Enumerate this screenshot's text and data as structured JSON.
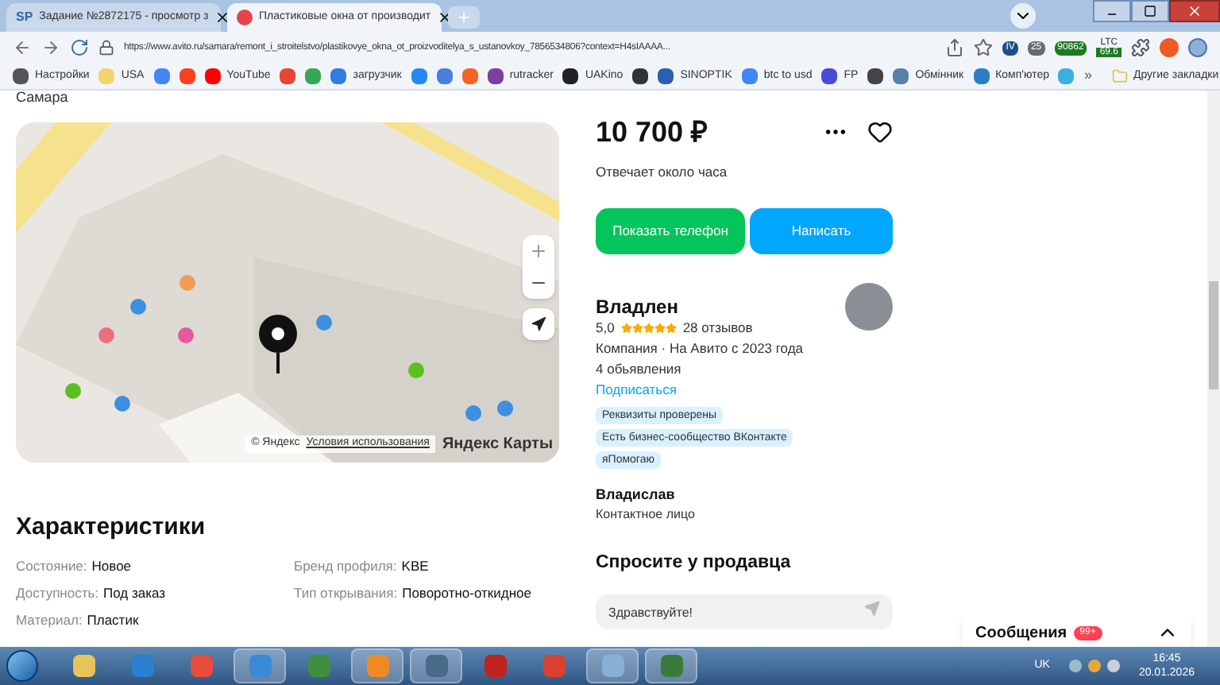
{
  "browser": {
    "tabs": [
      {
        "icon_text": "SP",
        "title": "Задание №2872175 - просмотр з",
        "selected": false
      },
      {
        "title": "Пластиковые окна от производит",
        "selected": true
      }
    ],
    "url": "https://www.avito.ru/samara/remont_i_stroitelstvo/plastikovye_okna_ot_proizvoditelya_s_ustanovkoy_7856534806?context=H4sIAAAA...",
    "extension_badges": [
      {
        "text": "IV",
        "color": "#1e4f8a"
      },
      {
        "text": "25",
        "color": "#6b6b6b"
      },
      {
        "text": "90862",
        "color": "#1f7a1f"
      },
      {
        "text": "69.6",
        "color": "#1f7a1f"
      }
    ],
    "extension_label": "LTC",
    "bookmarks": [
      {
        "label": "Настройки",
        "color": "#555555"
      },
      {
        "label": "USA",
        "color": "#f5d36b"
      },
      {
        "color": "#4285f4"
      },
      {
        "color": "#fc3f1d"
      },
      {
        "label": "YouTube",
        "color": "#ff0000"
      },
      {
        "color": "#ea4335"
      },
      {
        "color": "#34a853"
      },
      {
        "label": "загрузчик",
        "color": "#2f7de1"
      },
      {
        "color": "#2787f5"
      },
      {
        "color": "#4a7fe0"
      },
      {
        "color": "#f26522"
      },
      {
        "label": "rutracker",
        "color": "#7a3fa0"
      },
      {
        "label": "UAKino",
        "color": "#222222"
      },
      {
        "color": "#333333"
      },
      {
        "label": "SINOPTIK",
        "color": "#2b5fb0"
      },
      {
        "label": "btc to usd",
        "color": "#4285f4"
      },
      {
        "label": "FP",
        "color": "#4a4ad8"
      },
      {
        "color": "#444444"
      },
      {
        "label": "Обмінник",
        "color": "#5a7fa8"
      },
      {
        "label": "Комп'ютер",
        "color": "#2a7fc0"
      },
      {
        "color": "#3ab0e0"
      }
    ],
    "bookmarks_more": "»",
    "other_bookmarks": "Другие закладки"
  },
  "page": {
    "city": "Самара",
    "map": {
      "attribution": "© Яндекс",
      "terms_link": "Условия использования",
      "logo": "Яндекс Карты"
    },
    "characteristics": {
      "title": "Характеристики",
      "columns": [
        [
          {
            "label": "Состояние:",
            "value": "Новое"
          },
          {
            "label": "Доступность:",
            "value": "Под заказ"
          },
          {
            "label": "Материал:",
            "value": "Пластик"
          }
        ],
        [
          {
            "label": "Бренд профиля:",
            "value": "KBE"
          },
          {
            "label": "Тип открывания:",
            "value": "Поворотно-откидное"
          }
        ]
      ]
    },
    "price": "10 700 ₽",
    "favorite": false,
    "response_time": "Отвечает около часа",
    "buttons": [
      {
        "label": "Показать телефон",
        "kind": "phone"
      },
      {
        "label": "Написать",
        "kind": "message"
      }
    ],
    "seller": {
      "name": "Владлен",
      "rating": "5,0",
      "stars": 5,
      "reviews": "28 отзывов",
      "info": "Компания · На Авито с 2023 года",
      "listings": "4 обьявления",
      "subscribe": "Подписаться",
      "badges": [
        "Реквизиты проверены",
        "Есть бизнес-сообщество ВКонтакте",
        "яПомогаю"
      ]
    },
    "contact": {
      "name": "Владислав",
      "role": "Контактное лицо"
    },
    "ask": {
      "title": "Спросите у продавца",
      "value": "Здравствуйте!"
    },
    "messages": {
      "title": "Сообщения",
      "count": "99+"
    }
  },
  "taskbar": {
    "apps": [
      {
        "color": "#e8c25a",
        "running": false
      },
      {
        "color": "#2b7fd0",
        "running": false
      },
      {
        "color": "#e74c3c",
        "running": false
      },
      {
        "color": "#3a8ad8",
        "running": true
      },
      {
        "color": "#3f8f3f",
        "running": false
      },
      {
        "color": "#f08a24",
        "running": true
      },
      {
        "color": "#4a6a8a",
        "running": true
      },
      {
        "color": "#c0221e",
        "running": false
      },
      {
        "color": "#d94030",
        "running": false
      },
      {
        "color": "#8ab0d8",
        "running": true
      },
      {
        "color": "#3a7a3a",
        "running": true
      }
    ],
    "language": "UK",
    "time": "16:45",
    "date": "20.01.2026"
  }
}
